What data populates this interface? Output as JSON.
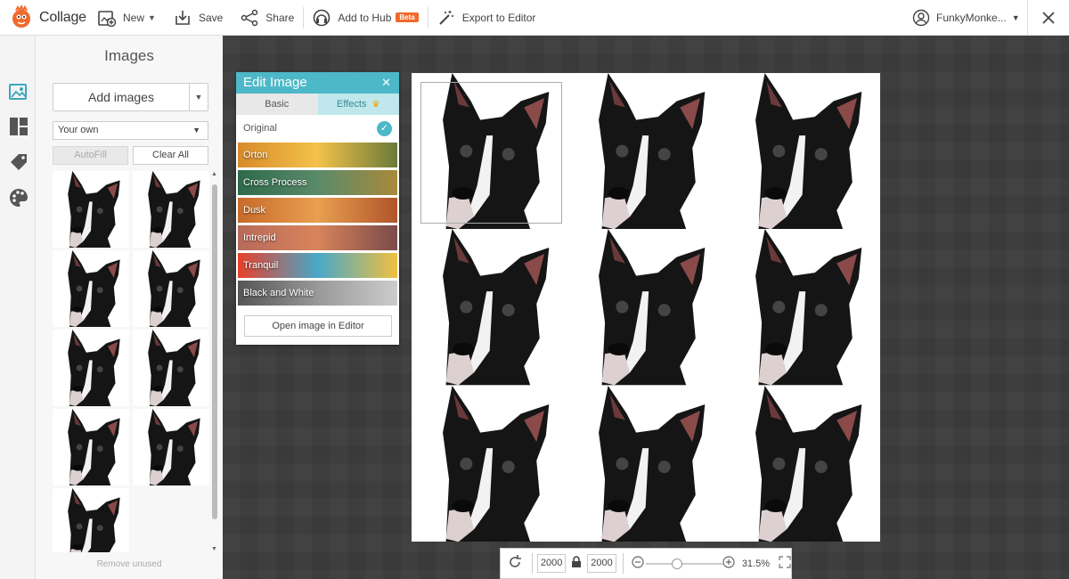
{
  "app": {
    "name": "Collage"
  },
  "toolbar": {
    "new_label": "New",
    "save_label": "Save",
    "share_label": "Share",
    "hub_label": "Add to Hub",
    "hub_badge": "Beta",
    "export_label": "Export to Editor"
  },
  "user": {
    "name": "FunkyMonke..."
  },
  "images_panel": {
    "title": "Images",
    "add_images_label": "Add images",
    "source_select": "Your own",
    "autofill_label": "AutoFill",
    "clear_all_label": "Clear All",
    "thumbnail_count": 9,
    "remove_unused_label": "Remove unused"
  },
  "edit_image": {
    "title": "Edit Image",
    "tabs": [
      "Basic",
      "Effects"
    ],
    "active_tab": "Effects",
    "original_label": "Original",
    "effects": [
      {
        "name": "Orton",
        "colors": [
          "#d88a2a",
          "#f4c24a",
          "#6a7a3a"
        ]
      },
      {
        "name": "Cross Process",
        "colors": [
          "#2e6a4a",
          "#5a8a6a",
          "#a88a3a"
        ]
      },
      {
        "name": "Dusk",
        "colors": [
          "#c86a2a",
          "#e8a050",
          "#b0542a"
        ]
      },
      {
        "name": "Intrepid",
        "colors": [
          "#b86a5a",
          "#d8845a",
          "#7a4a4a"
        ]
      },
      {
        "name": "Tranquil",
        "colors": [
          "#e8402a",
          "#48a8c8",
          "#f0c040"
        ]
      },
      {
        "name": "Black and White",
        "colors": [
          "#555555",
          "#999999",
          "#cccccc"
        ]
      }
    ],
    "open_editor_label": "Open image in Editor"
  },
  "canvas": {
    "grid_rows": 3,
    "grid_cols": 3
  },
  "bottom_bar": {
    "width_value": "2000",
    "height_value": "2000",
    "zoom_percent": "31.5%",
    "zoom_level": 0.4
  },
  "colors": {
    "accent": "#4db8c8",
    "logo": "#f06a2a",
    "beta": "#f06a2a",
    "workspace": "#3a3a3a"
  }
}
